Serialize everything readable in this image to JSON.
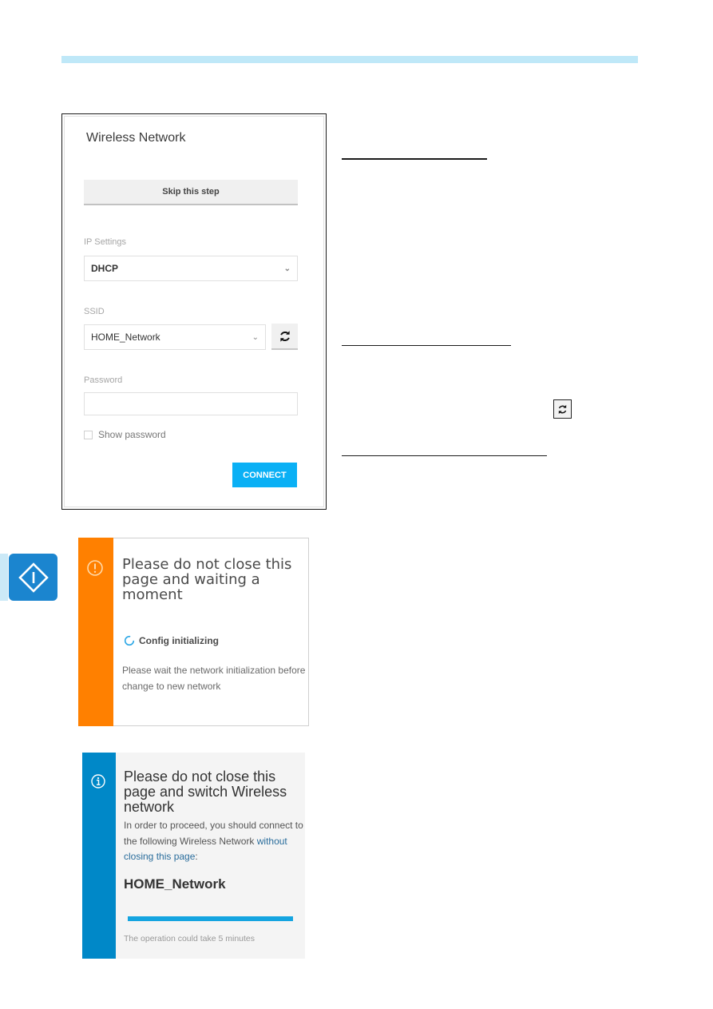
{
  "header": {
    "band_color": "#bfe8f8"
  },
  "wireless_form": {
    "title": "Wireless Network",
    "skip_label": "Skip this step",
    "ip_settings": {
      "label": "IP Settings",
      "value": "DHCP"
    },
    "ssid": {
      "label": "SSID",
      "value": "HOME_Network",
      "refresh_icon": "refresh-icon"
    },
    "password": {
      "label": "Password",
      "value": "",
      "placeholder": ""
    },
    "show_password": {
      "label": "Show password",
      "checked": false
    },
    "connect_label": "CONNECT",
    "accent_color": "#0ab0f5"
  },
  "side_tab": {
    "icon": "diamond-info-icon",
    "color": "#1b85cf"
  },
  "init_alert": {
    "icon": "exclamation-circle-icon",
    "accent_color": "#ff8000",
    "title": "Please do not close this page and waiting a moment",
    "status": "Config initializing",
    "description": "Please wait the network initialization before change to new network"
  },
  "switch_panel": {
    "icon": "info-circle-icon",
    "accent_color": "#0088c8",
    "title": "Please do not close this page and switch Wireless network",
    "description_prefix": "In order to proceed, you should connect to the following Wireless Network ",
    "description_link": "without closing this page",
    "description_suffix": ":",
    "network_name": "HOME_Network",
    "progress_percent": 100,
    "note": "The operation could take 5 minutes"
  }
}
